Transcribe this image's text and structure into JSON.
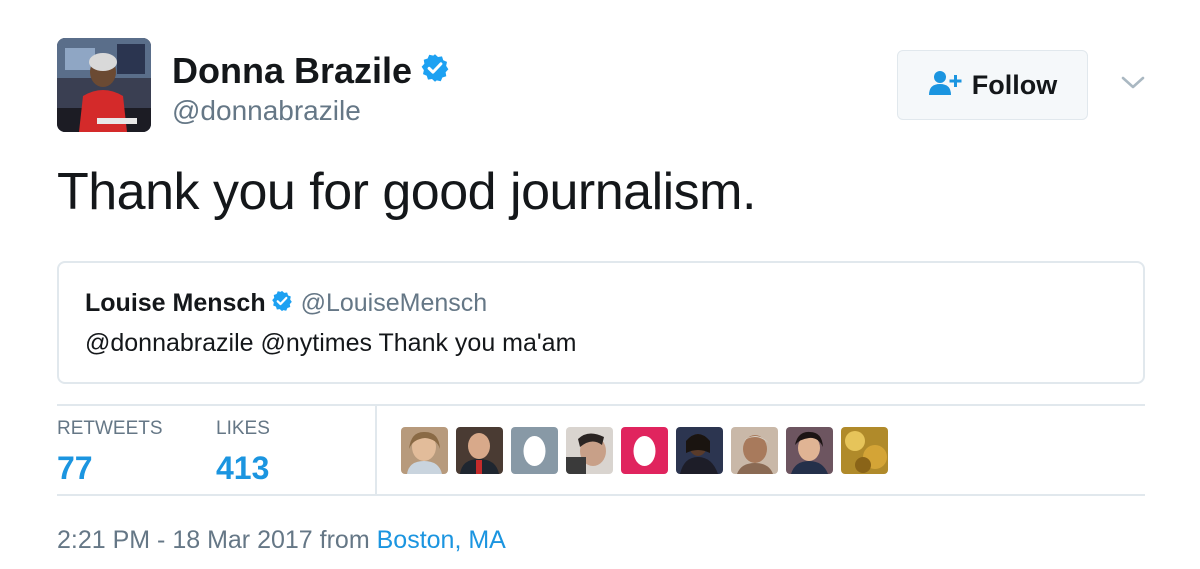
{
  "author": {
    "name": "Donna Brazile",
    "handle": "@donnabrazile",
    "verified": true
  },
  "follow_button": {
    "label": "Follow",
    "icon": "follow-user-icon"
  },
  "tweet": {
    "text": "Thank you for good journalism."
  },
  "quoted_tweet": {
    "name": "Louise Mensch",
    "handle": "@LouiseMensch",
    "verified": true,
    "text": "@donnabrazile @nytimes Thank you ma'am"
  },
  "stats": {
    "retweets_label": "RETWEETS",
    "retweets_count": "77",
    "likes_label": "LIKES",
    "likes_count": "413"
  },
  "footer": {
    "timestamp": "2:21 PM - 18 Mar 2017",
    "from_text": "from",
    "location": "Boston, MA"
  },
  "colors": {
    "accent": "#1b95e0",
    "text_primary": "#14171a",
    "text_secondary": "#657786",
    "border": "#e1e8ed",
    "verified_badge": "#1da1f2"
  }
}
